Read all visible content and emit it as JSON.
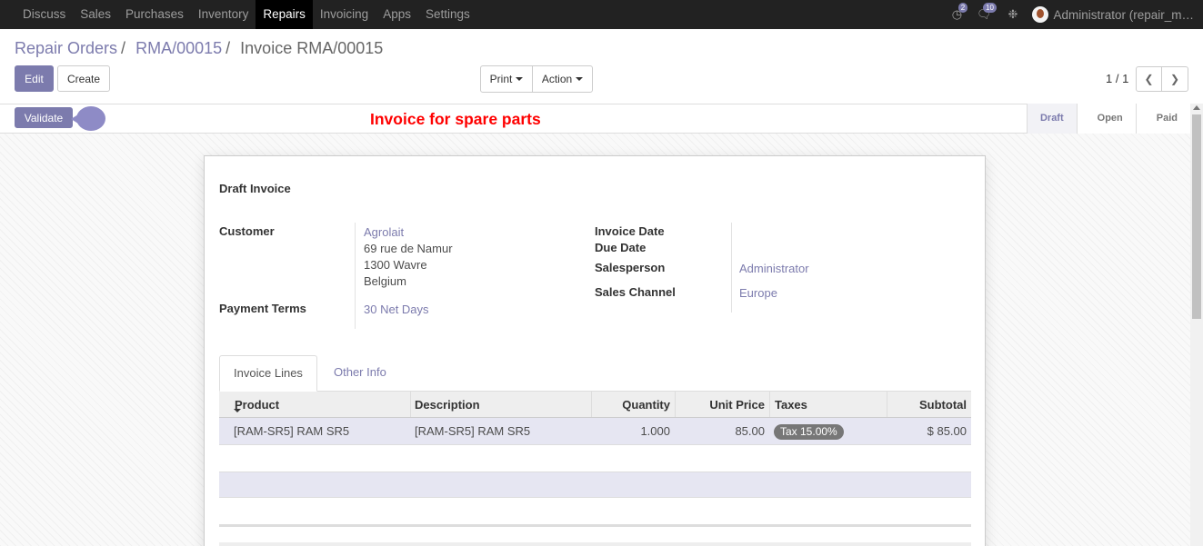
{
  "topbar": {
    "menu": [
      "Discuss",
      "Sales",
      "Purchases",
      "Inventory",
      "Repairs",
      "Invoicing",
      "Apps",
      "Settings"
    ],
    "active": "Repairs",
    "badge_activity": "2",
    "badge_messages": "10",
    "user_name": "Administrator (repair_m…"
  },
  "breadcrumb": {
    "root": "Repair Orders",
    "middle": "RMA/00015",
    "current": "Invoice RMA/00015",
    "sep": "/"
  },
  "buttons": {
    "edit": "Edit",
    "create": "Create",
    "print": "Print",
    "action": "Action",
    "validate": "Validate"
  },
  "pager": {
    "value": "1 / 1"
  },
  "annotation": "Invoice for spare parts",
  "stages": [
    "Draft",
    "Open",
    "Paid"
  ],
  "form": {
    "title": "Draft Invoice",
    "customer_label": "Customer",
    "customer_name": "Agrolait",
    "address": [
      "69 rue de Namur",
      "1300 Wavre",
      "Belgium"
    ],
    "payment_terms_label": "Payment Terms",
    "payment_terms": "30 Net Days",
    "invoice_date_label": "Invoice Date",
    "due_date_label": "Due Date",
    "salesperson_label": "Salesperson",
    "salesperson": "Administrator",
    "sales_channel_label": "Sales Channel",
    "sales_channel": "Europe"
  },
  "tabs": {
    "lines": "Invoice Lines",
    "other": "Other Info"
  },
  "grid": {
    "columns": [
      "Product",
      "Description",
      "Quantity",
      "Unit Price",
      "Taxes",
      "Subtotal"
    ],
    "rows": [
      {
        "product": "[RAM-SR5] RAM SR5",
        "description": "[RAM-SR5] RAM SR5",
        "quantity": "1.000",
        "unit_price": "85.00",
        "tax": "Tax 15.00%",
        "subtotal": "$ 85.00"
      }
    ]
  },
  "colors": {
    "accent": "#7c7bad",
    "annotation": "#ff0000",
    "topbar": "#222222"
  }
}
